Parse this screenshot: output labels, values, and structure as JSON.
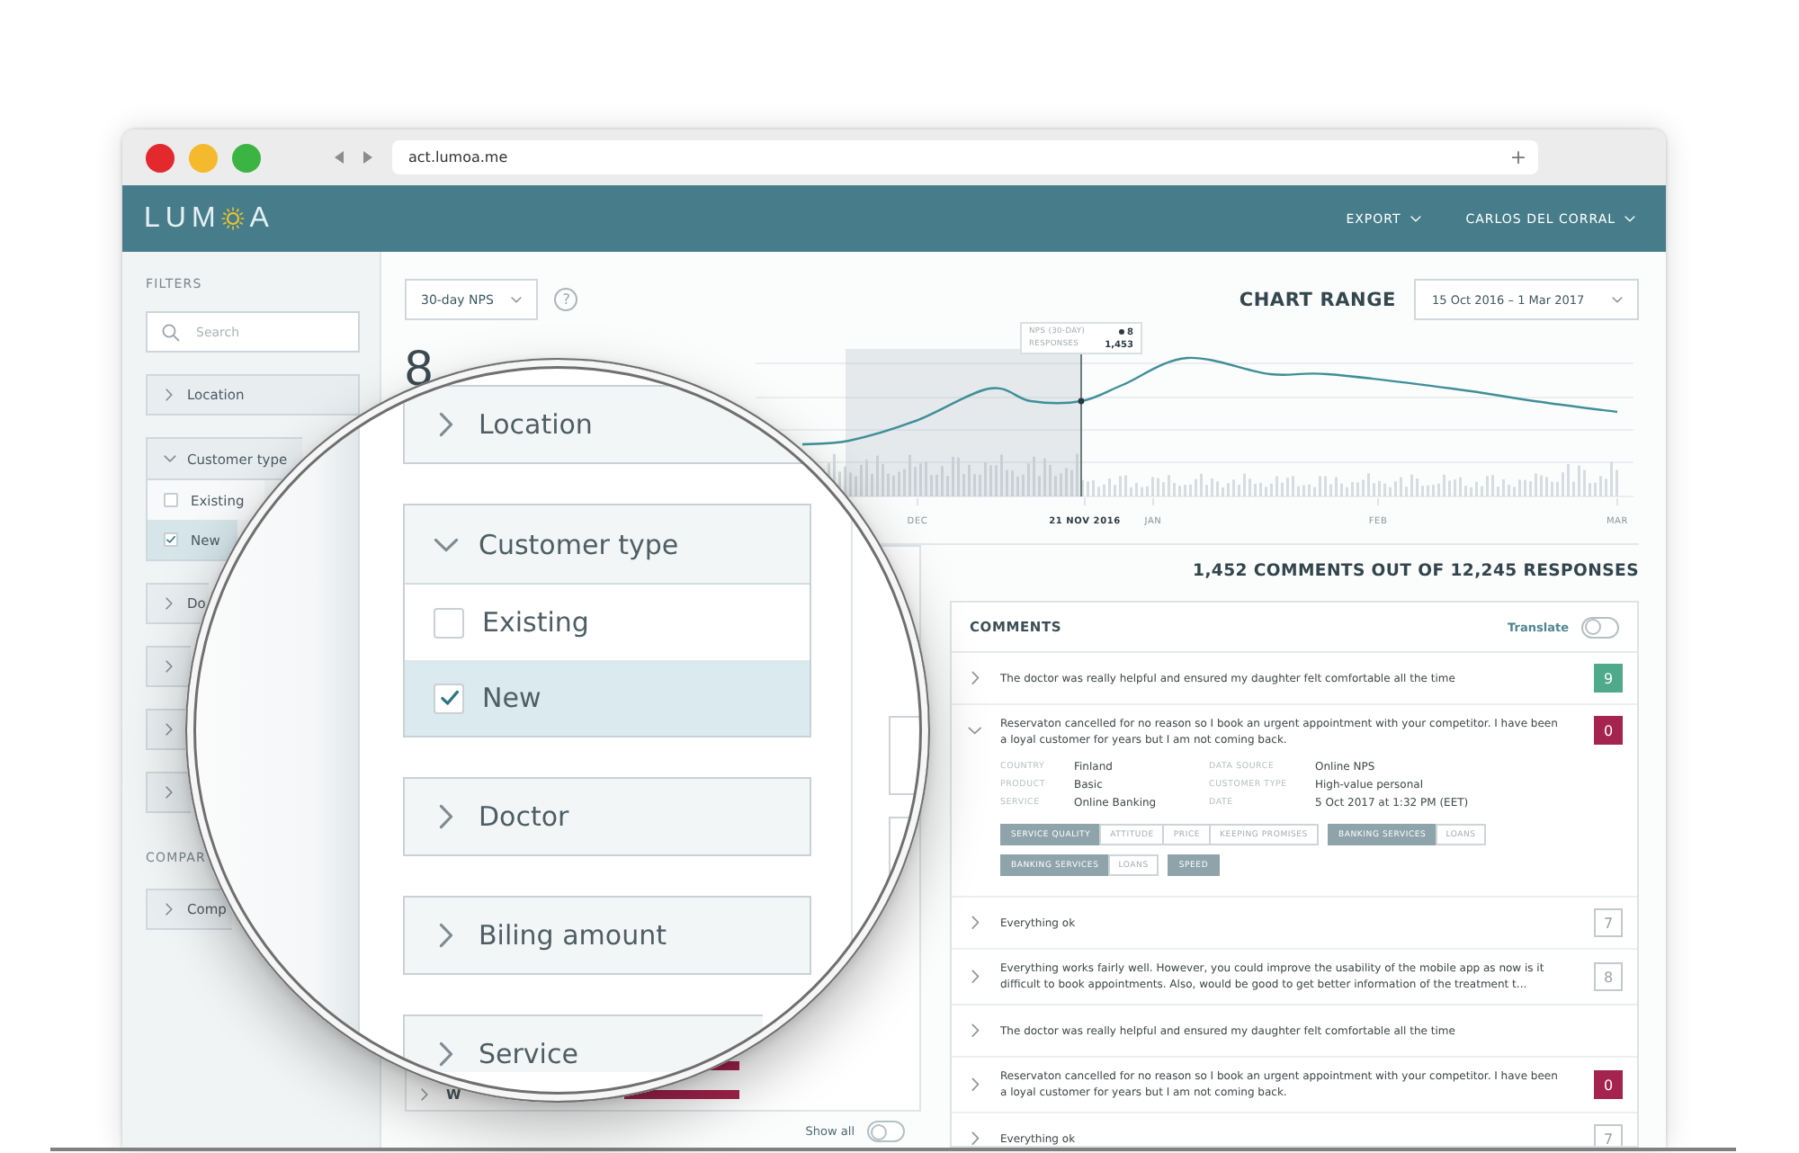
{
  "browser": {
    "url": "act.lumoa.me",
    "new_tab": "+"
  },
  "header": {
    "logo": {
      "start": "LUM",
      "end": "A"
    },
    "menus": [
      {
        "label": "EXPORT"
      },
      {
        "label": "CARLOS DEL CORRAL"
      }
    ]
  },
  "sidebar": {
    "title": "FILTERS",
    "search": {
      "placeholder": "Search"
    },
    "filters": [
      {
        "label": "Location",
        "expanded": false
      },
      {
        "label": "Customer type",
        "expanded": true,
        "options": [
          {
            "label": "Existing",
            "checked": false
          },
          {
            "label": "New",
            "checked": true
          }
        ]
      },
      {
        "label": "Do",
        "expanded": false
      },
      {
        "expanded": false
      },
      {
        "expanded": false
      },
      {
        "expanded": false
      }
    ],
    "compare_title": "COMPAR",
    "compare": [
      {
        "label": "Comp",
        "expanded": false
      }
    ]
  },
  "toolbar": {
    "metric": "30-day NPS",
    "help": "?",
    "range_label": "CHART RANGE",
    "range": "15 Oct 2016 – 1 Mar 2017"
  },
  "nps_value": "8",
  "chart": {
    "tooltip": [
      {
        "label": "NPS (30-DAY)",
        "value": "8",
        "kind": "nps"
      },
      {
        "label": "RESPONSES",
        "value": "1,453",
        "kind": "count"
      }
    ],
    "x_labels": [
      {
        "label": "DEC",
        "selected": false
      },
      {
        "label": "21 NOV 2016",
        "selected": true
      },
      {
        "label": "JAN",
        "selected": false
      },
      {
        "label": "FEB",
        "selected": false
      },
      {
        "label": "MAR",
        "selected": false
      }
    ]
  },
  "middle_panel": {
    "rows": [
      {
        "kind": "bar"
      },
      {
        "kind": "labelled",
        "label": "W"
      }
    ],
    "show_all": {
      "label": "Show all",
      "on": false
    }
  },
  "comments": {
    "summary": "1,452 COMMENTS OUT OF 12,245 RESPONSES",
    "title": "COMMENTS",
    "translate": {
      "label": "Translate",
      "on": false
    },
    "rows": [
      {
        "text": "The doctor was really helpful and ensured my daughter felt comfortable all the time",
        "expanded": false,
        "score": {
          "value": "9",
          "kind": "promoter"
        }
      },
      {
        "text": "Reservaton cancelled for no reason so I book an urgent appointment with your competitor. I have been a loyal customer for years but I am not coming back.",
        "expanded": true,
        "score": {
          "value": "0",
          "kind": "detractor"
        },
        "details": [
          [
            {
              "label": "COUNTRY",
              "value": "Finland"
            },
            {
              "label": "PRODUCT",
              "value": "Basic"
            },
            {
              "label": "SERVICE",
              "value": "Online Banking"
            }
          ],
          [
            {
              "label": "DATA SOURCE",
              "value": "Online NPS"
            },
            {
              "label": "CUSTOMER TYPE",
              "value": "High-value personal"
            },
            {
              "label": "DATE",
              "value": "5 Oct 2017 at 1:32 PM (EET)"
            }
          ]
        ],
        "tag_groups": [
          [
            {
              "label": "SERVICE QUALITY",
              "kind": "category"
            },
            {
              "label": "ATTITUDE",
              "kind": "topic"
            },
            {
              "label": "PRICE",
              "kind": "topic"
            },
            {
              "label": "KEEPING PROMISES",
              "kind": "topic"
            }
          ],
          [
            {
              "label": "BANKING SERVICES",
              "kind": "category"
            },
            {
              "label": "LOANS",
              "kind": "topic"
            }
          ],
          [
            {
              "label": "BANKING SERVICES",
              "kind": "category"
            },
            {
              "label": "LOANS",
              "kind": "topic"
            }
          ],
          [
            {
              "label": "SPEED",
              "kind": "category"
            }
          ]
        ]
      },
      {
        "text": "Everything ok",
        "expanded": false,
        "score": {
          "value": "7",
          "kind": "passive"
        }
      },
      {
        "text": "Everything works fairly well. However, you could improve the usability of the mobile app as now is it difficult to book appointments. Also, would be good to get better information of the treatment t...",
        "expanded": false,
        "score": {
          "value": "8",
          "kind": "passive"
        }
      },
      {
        "text": "The doctor was really helpful and ensured my daughter felt comfortable all the time",
        "expanded": false
      },
      {
        "text": "Reservaton cancelled for no reason so I book an urgent appointment with your competitor. I have been a loyal customer for years but I am not coming back.",
        "expanded": false,
        "score": {
          "value": "0",
          "kind": "detractor"
        }
      },
      {
        "text": "Everything ok",
        "expanded": false,
        "score": {
          "value": "7",
          "kind": "passive"
        }
      }
    ]
  },
  "magnifier": {
    "filters": [
      {
        "label": "Location",
        "expanded": false
      },
      {
        "label": "Customer type",
        "expanded": true,
        "options": [
          {
            "label": "Existing",
            "checked": false
          },
          {
            "label": "New",
            "checked": true
          }
        ]
      },
      {
        "label": "Doctor",
        "expanded": false
      },
      {
        "label": "Biling amount",
        "expanded": false
      },
      {
        "label": "Service",
        "expanded": false
      }
    ]
  }
}
